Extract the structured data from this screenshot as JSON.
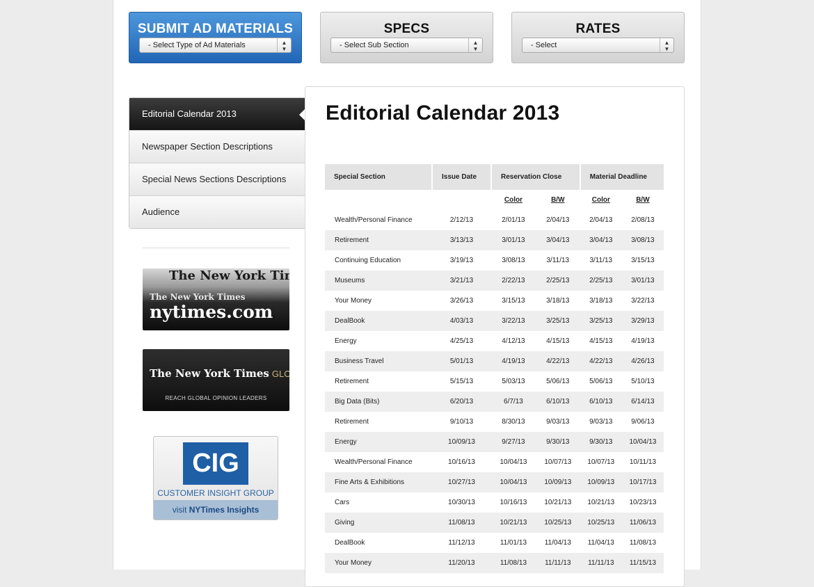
{
  "top": {
    "submit": {
      "title": "SUBMIT AD MATERIALS",
      "select": "- Select Type of Ad Materials"
    },
    "specs": {
      "title": "SPECS",
      "select": "- Select Sub Section"
    },
    "rates": {
      "title": "RATES",
      "select": "- Select"
    }
  },
  "nav": {
    "items": [
      {
        "label": "Editorial Calendar 2013"
      },
      {
        "label": "Newspaper Section Descriptions"
      },
      {
        "label": "Special News Sections Descriptions"
      },
      {
        "label": "Audience"
      }
    ]
  },
  "ads": {
    "nytimes": {
      "line1": "The New York Times",
      "line2": "The New York Times",
      "line3": "nytimes.com"
    },
    "global": {
      "line1": "The New York Times",
      "line1b": "GLOBAL",
      "line2": "REACH GLOBAL OPINION LEADERS"
    },
    "cig": {
      "logo": "CIG",
      "name": "CUSTOMER INSIGHT GROUP",
      "visit": "visit",
      "visit_bold": "NYTimes Insights"
    }
  },
  "content": {
    "title": "Editorial Calendar 2013",
    "headers": [
      "Special Section",
      "Issue Date",
      "Reservation Close",
      "Material Deadline"
    ],
    "subheaders": [
      "Color",
      "B/W",
      "Color",
      "B/W"
    ],
    "rows": [
      [
        "Wealth/Personal Finance",
        "2/12/13",
        "2/01/13",
        "2/04/13",
        "2/04/13",
        "2/08/13"
      ],
      [
        "Retirement",
        "3/13/13",
        "3/01/13",
        "3/04/13",
        "3/04/13",
        "3/08/13"
      ],
      [
        "Continuing Education",
        "3/19/13",
        "3/08/13",
        "3/11/13",
        "3/11/13",
        "3/15/13"
      ],
      [
        "Museums",
        "3/21/13",
        "2/22/13",
        "2/25/13",
        "2/25/13",
        "3/01/13"
      ],
      [
        "Your Money",
        "3/26/13",
        "3/15/13",
        "3/18/13",
        "3/18/13",
        "3/22/13"
      ],
      [
        "DealBook",
        "4/03/13",
        "3/22/13",
        "3/25/13",
        "3/25/13",
        "3/29/13"
      ],
      [
        "Energy",
        "4/25/13",
        "4/12/13",
        "4/15/13",
        "4/15/13",
        "4/19/13"
      ],
      [
        "Business Travel",
        "5/01/13",
        "4/19/13",
        "4/22/13",
        "4/22/13",
        "4/26/13"
      ],
      [
        "Retirement",
        "5/15/13",
        "5/03/13",
        "5/06/13",
        "5/06/13",
        "5/10/13"
      ],
      [
        "Big Data (Bits)",
        "6/20/13",
        "6/7/13",
        "6/10/13",
        "6/10/13",
        "6/14/13"
      ],
      [
        "Retirement",
        "9/10/13",
        "8/30/13",
        "9/03/13",
        "9/03/13",
        "9/06/13"
      ],
      [
        "Energy",
        "10/09/13",
        "9/27/13",
        "9/30/13",
        "9/30/13",
        "10/04/13"
      ],
      [
        "Wealth/Personal Finance",
        "10/16/13",
        "10/04/13",
        "10/07/13",
        "10/07/13",
        "10/11/13"
      ],
      [
        "Fine Arts & Exhibitions",
        "10/27/13",
        "10/04/13",
        "10/09/13",
        "10/09/13",
        "10/17/13"
      ],
      [
        "Cars",
        "10/30/13",
        "10/16/13",
        "10/21/13",
        "10/21/13",
        "10/23/13"
      ],
      [
        "Giving",
        "11/08/13",
        "10/21/13",
        "10/25/13",
        "10/25/13",
        "11/06/13"
      ],
      [
        "DealBook",
        "11/12/13",
        "11/01/13",
        "11/04/13",
        "11/04/13",
        "11/08/13"
      ],
      [
        "Your Money",
        "11/20/13",
        "11/08/13",
        "11/11/13",
        "11/11/13",
        "11/15/13"
      ]
    ]
  }
}
